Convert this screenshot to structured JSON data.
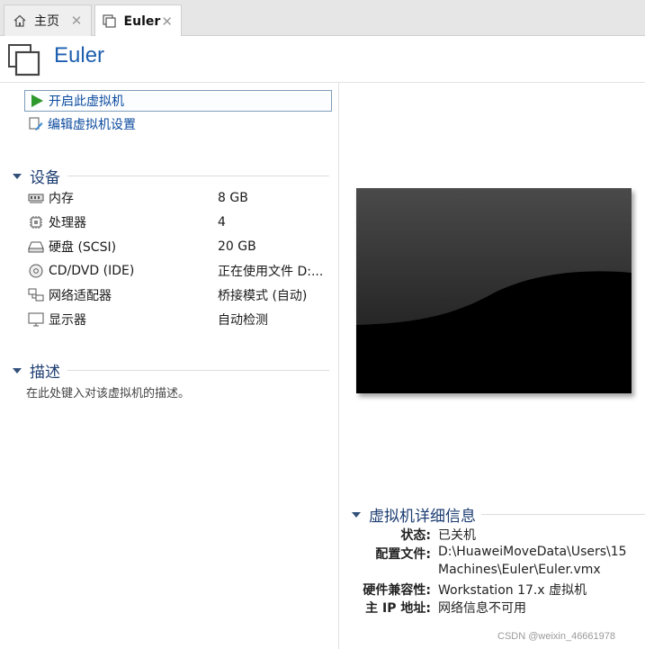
{
  "tabs": [
    {
      "label": "主页",
      "icon": "home-icon"
    },
    {
      "label": "Euler",
      "icon": "vm-icon"
    }
  ],
  "vm": {
    "name": "Euler"
  },
  "commands": {
    "start": "开启此虚拟机",
    "edit": "编辑虚拟机设置"
  },
  "devices": {
    "title": "设备",
    "items": [
      {
        "name": "内存",
        "value": "8 GB",
        "icon": "memory-icon"
      },
      {
        "name": "处理器",
        "value": "4",
        "icon": "processor-icon"
      },
      {
        "name": "硬盘 (SCSI)",
        "value": "20 GB",
        "icon": "harddisk-icon"
      },
      {
        "name": "CD/DVD (IDE)",
        "value": "正在使用文件 D:...",
        "icon": "cd-dvd-icon"
      },
      {
        "name": "网络适配器",
        "value": "桥接模式 (自动)",
        "icon": "network-adapter-icon"
      },
      {
        "name": "显示器",
        "value": "自动检测",
        "icon": "display-icon"
      }
    ]
  },
  "description": {
    "title": "描述",
    "placeholder": "在此处键入对该虚拟机的描述。"
  },
  "details": {
    "title": "虚拟机详细信息",
    "rows": [
      {
        "key": "状态:",
        "value": "已关机"
      },
      {
        "key": "配置文件:",
        "value": "D:\\HuaweiMoveData\\Users\\15"
      },
      {
        "key": "",
        "value": "Machines\\Euler\\Euler.vmx"
      },
      {
        "key": "硬件兼容性:",
        "value": "Workstation 17.x 虚拟机"
      },
      {
        "key": "主 IP 地址:",
        "value": "网络信息不可用"
      }
    ]
  },
  "watermark": "CSDN @weixin_46661978",
  "colors": {
    "accent": "#1d5fb0",
    "section": "#1d3d72",
    "play": "#2e9a2e"
  }
}
